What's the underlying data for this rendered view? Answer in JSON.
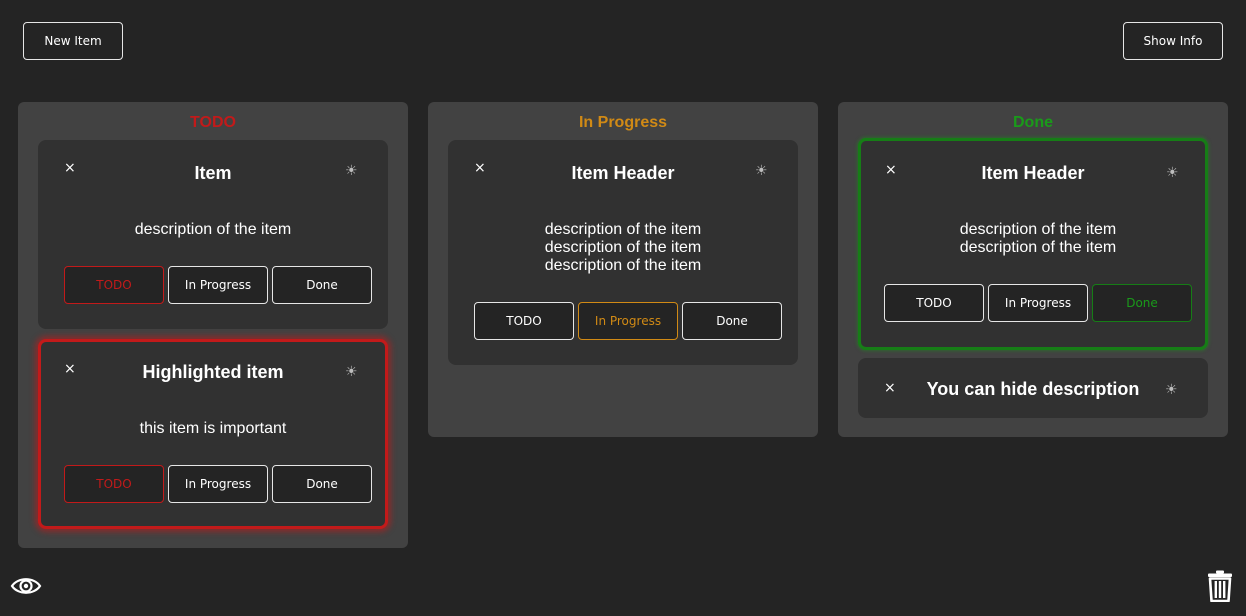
{
  "toolbar": {
    "new_item": "New Item",
    "show_info": "Show Info"
  },
  "status_labels": {
    "todo": "TODO",
    "in_progress": "In Progress",
    "done": "Done"
  },
  "colors": {
    "todo": "#c21a1a",
    "in_progress": "#d18a15",
    "done": "#1a9a1a"
  },
  "icons": {
    "close": "×",
    "sun": "☀",
    "eye": "eye-icon",
    "trash": "trash-icon"
  },
  "columns": [
    {
      "title": "TODO",
      "cards": [
        {
          "title": "Item",
          "description": [
            "description of the item"
          ],
          "status": "todo"
        },
        {
          "title": "Highlighted item",
          "description": [
            "this item is important"
          ],
          "status": "todo",
          "highlighted": true
        }
      ]
    },
    {
      "title": "In Progress",
      "cards": [
        {
          "title": "Item Header",
          "description": [
            "description of the item",
            "description of the item",
            "description of the item"
          ],
          "status": "in_progress"
        }
      ]
    },
    {
      "title": "Done",
      "cards": [
        {
          "title": "Item Header",
          "description": [
            "description of the item",
            "description of the item"
          ],
          "status": "done"
        },
        {
          "title": "You can hide description",
          "description": [],
          "status": "done",
          "collapsed": true
        }
      ]
    }
  ]
}
